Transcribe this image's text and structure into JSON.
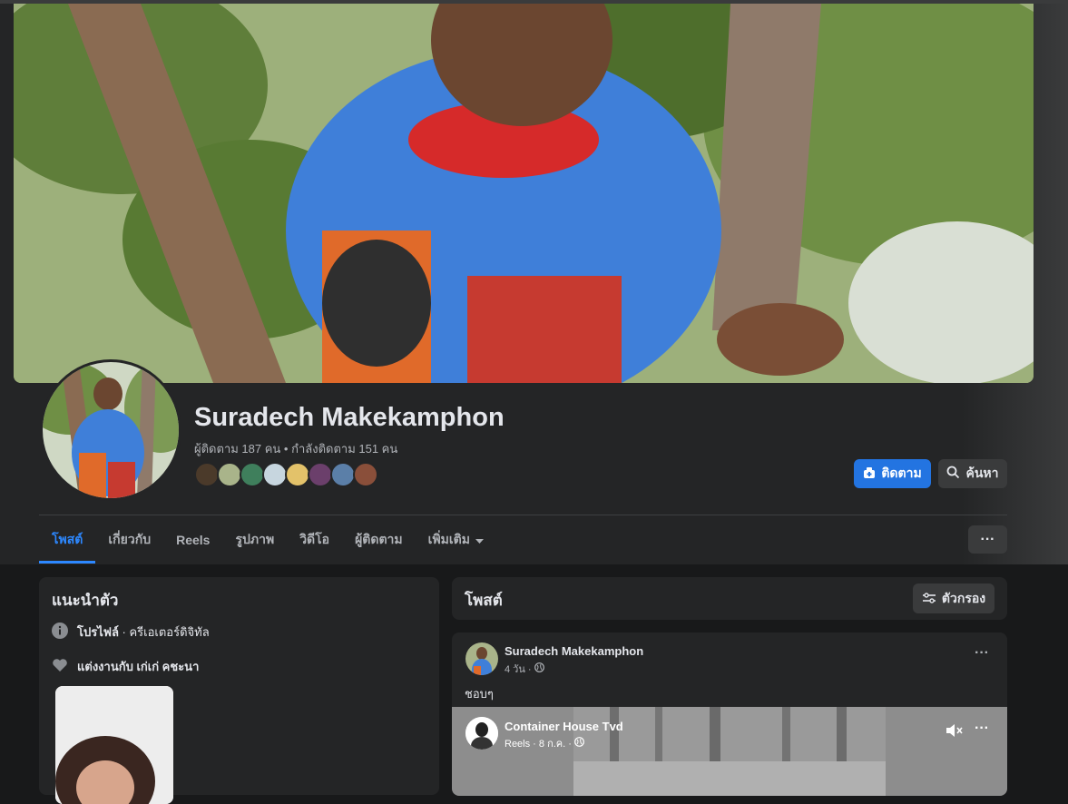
{
  "profile": {
    "name": "Suradech Makekamphon",
    "stats": "ผู้ติดตาม 187 คน • กำลังติดตาม 151 คน",
    "follow_label": "ติดตาม",
    "search_label": "ค้นหา"
  },
  "tabs": [
    {
      "label": "โพสต์",
      "active": true
    },
    {
      "label": "เกี่ยวกับ"
    },
    {
      "label": "Reels"
    },
    {
      "label": "รูปภาพ"
    },
    {
      "label": "วิดีโอ"
    },
    {
      "label": "ผู้ติดตาม"
    },
    {
      "label": "เพิ่มเติม"
    }
  ],
  "more_button": "···",
  "intro": {
    "title": "แนะนำตัว",
    "rows": [
      {
        "bold": "โปรไฟล์",
        "rest": " · ครีเอเตอร์ดิจิทัล",
        "icon": "info-icon"
      },
      {
        "bold": "แต่งงานกับ เก่เก่ คชะนา",
        "rest": "",
        "icon": "heart-icon"
      }
    ]
  },
  "posts_header": {
    "title": "โพสต์",
    "filter_label": "ตัวกรอง"
  },
  "post": {
    "author": "Suradech Makekamphon",
    "time": "4 วัน ·",
    "text": "ชอบๆ",
    "menu": "···",
    "shared_reel": {
      "author": "Container House Tvd",
      "meta": "Reels · 8 ก.ค. ·",
      "menu": "···"
    }
  },
  "colors": {
    "accent": "#2d88ff",
    "follow_button": "#2374e1",
    "card": "#242526",
    "background": "#18191a"
  }
}
